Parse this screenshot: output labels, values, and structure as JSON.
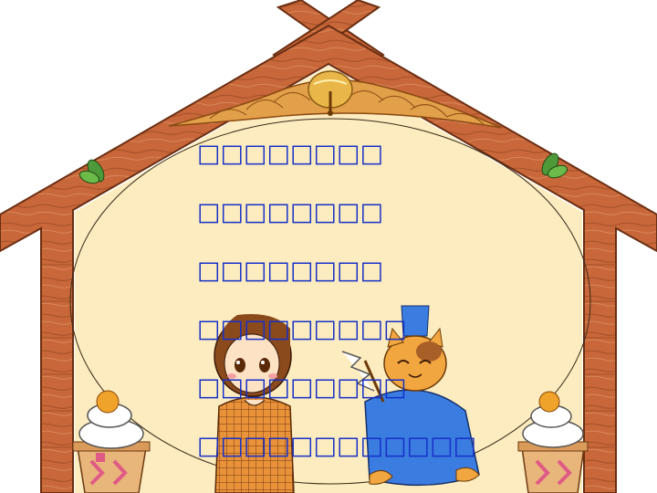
{
  "board": {
    "lines": [
      "□□□□□□□□",
      "□□□□□□□□",
      "□□□□□□□□",
      "□□□□□□□□□",
      "□□□□□□□□□",
      "□□□□□□□□□□□□"
    ],
    "text_color": "#1530c8"
  },
  "colors": {
    "wood": "#c8683a",
    "wood_dark": "#8a3f1c",
    "panel": "#fdecbf",
    "rope": "#e3a04a",
    "bell": "#e9b64a",
    "cat_robe": "#3b7ce0",
    "cat_fur": "#f2a640",
    "girl_robe": "#e8923a",
    "mochi_stand": "#e8b57a",
    "mochi_ribbon": "#e05a86",
    "mikan": "#f0a32a"
  },
  "icons": [
    "shimenawa-rope",
    "bell-icon",
    "leaf-icon",
    "kagami-mochi",
    "girl-character",
    "cat-character"
  ]
}
